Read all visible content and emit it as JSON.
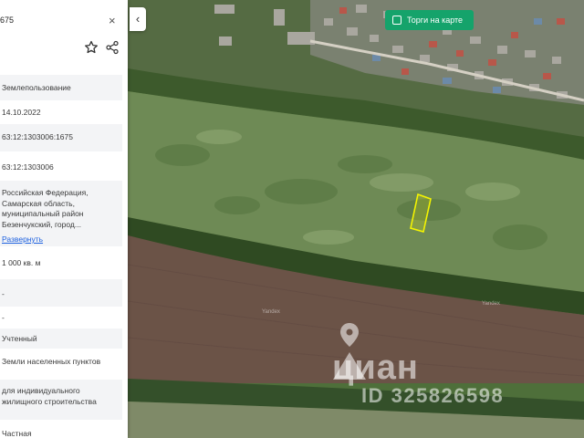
{
  "panel": {
    "title": "675",
    "close_label": "×",
    "rows": [
      {
        "id": "land-use",
        "text": "Землепользование"
      },
      {
        "id": "date",
        "text": "14.10.2022"
      },
      {
        "id": "cad-number",
        "text": "63:12:1303006:1675"
      },
      {
        "id": "cad-quarter",
        "text": "63:12:1303006"
      },
      {
        "id": "address",
        "text": "Российская Федерация, Самарская область, муниципальный район Безенчукский, город..."
      },
      {
        "id": "area",
        "text": "1 000 кв. м"
      },
      {
        "id": "dash1",
        "text": "-"
      },
      {
        "id": "dash2",
        "text": "-"
      },
      {
        "id": "status",
        "text": "Учтенный"
      },
      {
        "id": "category",
        "text": "Земли населенных пунктов"
      },
      {
        "id": "permitted-use",
        "text": "для индивидуального жилищного строительства"
      },
      {
        "id": "ownership",
        "text": "Частная"
      }
    ],
    "expand_link": "Развернуть"
  },
  "map": {
    "collapse_label": "‹",
    "torgi_label": "Торги на карте",
    "watermark_brand": "циан",
    "watermark_id": "ID 325826598",
    "yandex_labels": [
      "Yandex",
      "Yandex"
    ],
    "plot_color": "#f4f400",
    "accent_color": "#15a36b"
  }
}
